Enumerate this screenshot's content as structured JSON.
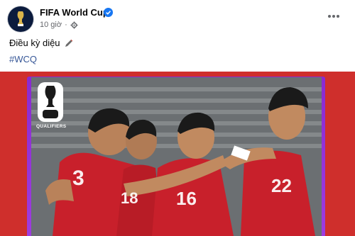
{
  "post": {
    "page_name": "FIFA World Cup",
    "time": "10 giờ",
    "caption": "Điều kỳ diệu",
    "hashtag": "#WCQ"
  },
  "media": {
    "logo_text": "QUALIFIERS",
    "jersey_numbers": [
      "3",
      "18",
      "16",
      "22"
    ]
  },
  "colors": {
    "link": "#385898",
    "verified": "#1877f2",
    "jersey": "#c8202b",
    "frame": "#8a2ad1"
  },
  "icons": [
    "fifa-trophy-icon",
    "verified-badge-icon",
    "globe-settings-icon",
    "more-options-icon",
    "pencil-icon"
  ]
}
